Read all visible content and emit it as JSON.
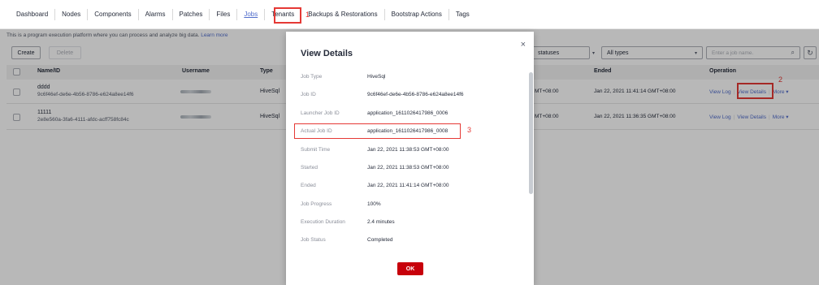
{
  "tabs": [
    "Dashboard",
    "Nodes",
    "Components",
    "Alarms",
    "Patches",
    "Files",
    "Jobs",
    "Tenants",
    "Backups & Restorations",
    "Bootstrap Actions",
    "Tags"
  ],
  "active_tab": "Jobs",
  "annotations": {
    "a1": "1",
    "a2": "2",
    "a3": "3"
  },
  "intro": {
    "text": "This is a program execution platform where you can process and analyze big data.",
    "link": "Learn more"
  },
  "toolbar": {
    "create": "Create",
    "delete": "Delete",
    "status_filter": "statuses",
    "type_filter": "All types",
    "search_placeholder": "Enter a job name.",
    "search_icon": "search-icon",
    "refresh_icon": "refresh-icon"
  },
  "table": {
    "headers": {
      "name": "Name/ID",
      "username": "Username",
      "type": "Type",
      "ended": "Ended",
      "operation": "Operation"
    },
    "rows": [
      {
        "name": "dddd",
        "id": "9c6f46ef-de6e-4b56-8786-e624a8ee14f6",
        "type": "HiveSql",
        "started_suffix": "MT+08:00",
        "ended": "Jan 22, 2021 11:41:14 GMT+08:00"
      },
      {
        "name": "11111",
        "id": "2e8e560a-3fa6-4111-afdc-acff758fc84c",
        "type": "HiveSql",
        "started_suffix": "MT+08:00",
        "ended": "Jan 22, 2021 11:36:35 GMT+08:00"
      }
    ],
    "ops": {
      "view_log": "View Log",
      "view_details": "View Details",
      "more": "More ▾"
    }
  },
  "modal": {
    "title": "View Details",
    "close": "×",
    "fields": [
      {
        "label": "Job Type",
        "value": "HiveSql"
      },
      {
        "label": "Job ID",
        "value": "9c6f46ef-de6e-4b56-8786-e624a8ee14f6"
      },
      {
        "label": "Launcher Job ID",
        "value": "application_1611026417986_0006"
      },
      {
        "label": "Actual Job ID",
        "value": "application_1611026417986_0008"
      },
      {
        "label": "Submit Time",
        "value": "Jan 22, 2021 11:38:53 GMT+08:00"
      },
      {
        "label": "Started",
        "value": "Jan 22, 2021 11:38:53 GMT+08:00"
      },
      {
        "label": "Ended",
        "value": "Jan 22, 2021 11:41:14 GMT+08:00"
      },
      {
        "label": "Job Progress",
        "value": "100%"
      },
      {
        "label": "Execution Duration",
        "value": "2.4 minutes"
      },
      {
        "label": "Job Status",
        "value": "Completed"
      }
    ],
    "ok": "OK"
  }
}
